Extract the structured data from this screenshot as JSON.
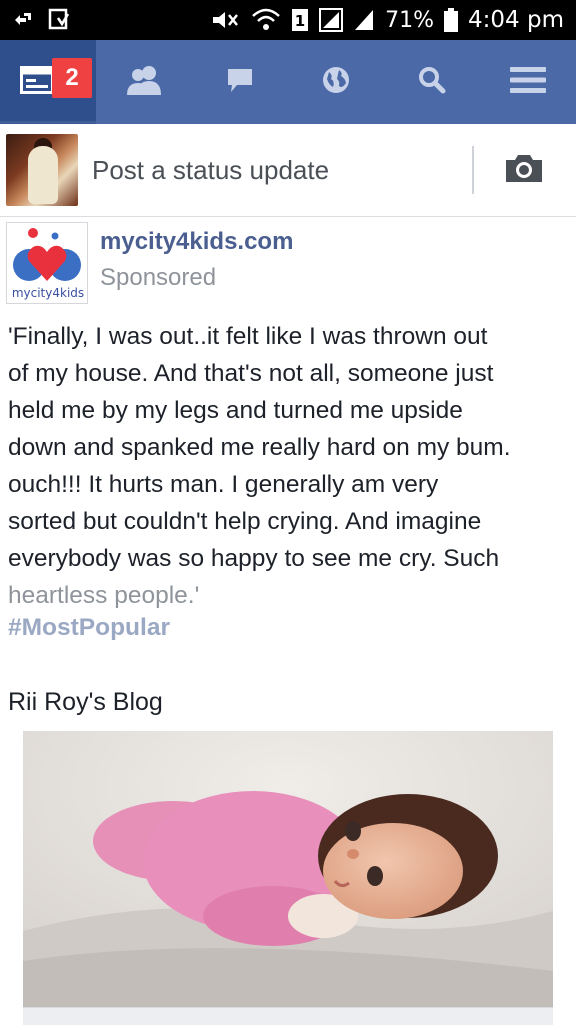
{
  "status_bar": {
    "battery": "71%",
    "time": "4:04 pm",
    "icons": [
      "usb-debug-icon",
      "download-icon",
      "mute-icon",
      "wifi-icon",
      "sim-1-icon",
      "signal-icon",
      "signal-2-icon",
      "battery-icon"
    ]
  },
  "nav": {
    "tabs": [
      {
        "name": "news-feed",
        "icon": "news-feed-icon",
        "badge": "2",
        "active": true
      },
      {
        "name": "friends",
        "icon": "friends-icon"
      },
      {
        "name": "messages",
        "icon": "chat-icon"
      },
      {
        "name": "notifications",
        "icon": "globe-icon"
      },
      {
        "name": "search",
        "icon": "search-icon"
      },
      {
        "name": "menu",
        "icon": "menu-icon"
      }
    ],
    "badge": "2",
    "colors": {
      "bar": "#4a69a6",
      "active": "#2e4f8c",
      "badge": "#ef4141"
    }
  },
  "composer": {
    "placeholder": "Post a status update",
    "camera_icon": "camera-icon"
  },
  "post": {
    "page_name": "mycity4kids.com",
    "sponsored": "Sponsored",
    "logo_caption": "mycity4kids",
    "body_lines": [
      "'Finally, I was out..it felt like I was thrown out",
      "of my house. And that's not all, someone just",
      "held me  by my legs and turned me upside",
      "down and spanked me really hard on my bum.",
      "ouch!!! It hurts man. I generally am very",
      "sorted but couldn't help crying. And imagine",
      "everybody was so happy to see me cry. Such",
      "heartless people.'"
    ],
    "hashtag": "#MostPopular",
    "blog_title": "Rii Roy's Blog"
  }
}
